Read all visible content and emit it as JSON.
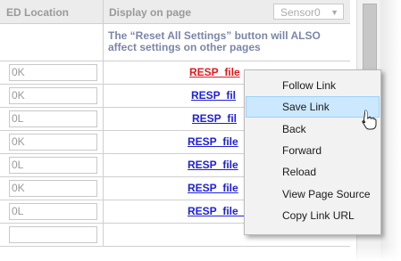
{
  "header": {
    "location_col": "ED Location",
    "display_col": "Display on page",
    "sensor_select": "Sensor0"
  },
  "note": "The “Reset All Settings” button will ALSO affect settings on other pages",
  "rows": [
    {
      "location": "0K",
      "link": "RESP_file"
    },
    {
      "location": "0K",
      "link": "RESP_fil"
    },
    {
      "location": "0L",
      "link": "RESP_fil"
    },
    {
      "location": "0K",
      "link": "RESP_file"
    },
    {
      "location": "0L",
      "link": "RESP_file"
    },
    {
      "location": "0K",
      "link": "RESP_file"
    },
    {
      "location": "0L",
      "link": "RESP_file_16"
    }
  ],
  "context_menu": {
    "items": [
      "Follow Link",
      "Save Link",
      "Back",
      "Forward",
      "Reload",
      "View Page Source",
      "Copy Link URL"
    ],
    "highlighted": "Save Link"
  },
  "colors": {
    "link": "#1f20d8",
    "visited_link": "#e0191b",
    "menu_highlight": "#cce8ff"
  },
  "icons": [
    "chevron-down-icon",
    "pointer-cursor-icon"
  ]
}
